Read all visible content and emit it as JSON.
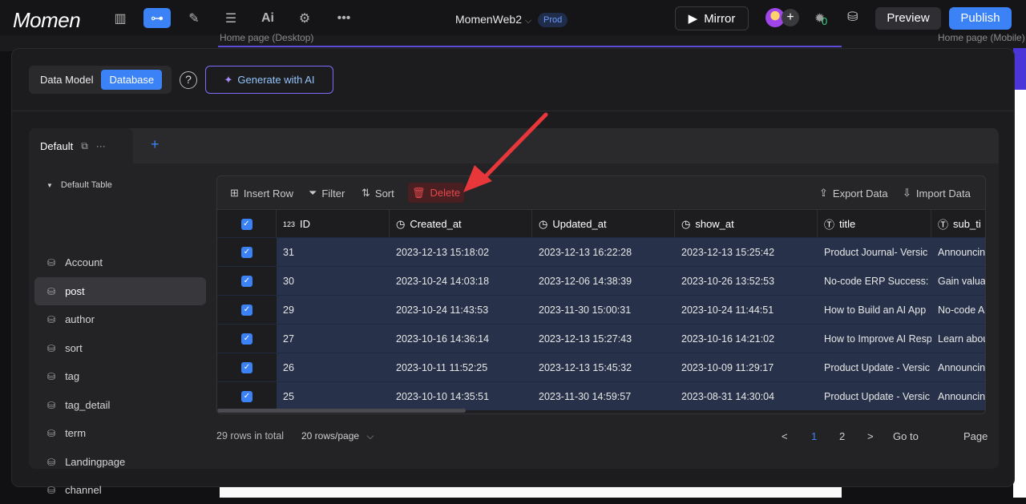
{
  "topbar": {
    "logo": "Momen",
    "project_name": "MomenWeb2",
    "env_badge": "Prod",
    "mirror_label": "Mirror",
    "bug_count": "0",
    "preview_label": "Preview",
    "publish_label": "Publish"
  },
  "background": {
    "left_page_label": "Home page (Desktop)",
    "right_page_label": "Home page (Mobile)"
  },
  "modal": {
    "seg_data_model": "Data Model",
    "seg_database": "Database",
    "help": "?",
    "generate_ai": "Generate with AI"
  },
  "panel": {
    "tab_name": "Default",
    "table_group": "Default Table",
    "tables": [
      "Account",
      "post",
      "author",
      "sort",
      "tag",
      "tag_detail",
      "term",
      "Landingpage",
      "channel"
    ],
    "selected_table": "post"
  },
  "toolbar": {
    "insert_row": "Insert Row",
    "filter": "Filter",
    "sort": "Sort",
    "delete": "Delete",
    "export": "Export Data",
    "import": "Import Data"
  },
  "columns": [
    {
      "label": "ID",
      "type": "123"
    },
    {
      "label": "Created_at",
      "type": "time"
    },
    {
      "label": "Updated_at",
      "type": "time"
    },
    {
      "label": "show_at",
      "type": "time"
    },
    {
      "label": "title",
      "type": "text"
    },
    {
      "label": "sub_ti",
      "type": "text"
    }
  ],
  "rows": [
    [
      "31",
      "2023-12-13 15:18:02",
      "2023-12-13 16:22:28",
      "2023-12-13 15:25:42",
      "Product Journal- Versic",
      "Announcin"
    ],
    [
      "30",
      "2023-10-24 14:03:18",
      "2023-12-06 14:38:39",
      "2023-10-26 13:52:53",
      "No-code ERP Success:",
      "Gain valua"
    ],
    [
      "29",
      "2023-10-24 11:43:53",
      "2023-11-30 15:00:31",
      "2023-10-24 11:44:51",
      "How to Build an AI App",
      "No-code A"
    ],
    [
      "27",
      "2023-10-16 14:36:14",
      "2023-12-13 15:27:43",
      "2023-10-16 14:21:02",
      "How to Improve AI Resp",
      "Learn abou"
    ],
    [
      "26",
      "2023-10-11 11:52:25",
      "2023-12-13 15:45:32",
      "2023-10-09 11:29:17",
      "Product Update - Versic",
      "Announcin"
    ],
    [
      "25",
      "2023-10-10 14:35:51",
      "2023-11-30 14:59:57",
      "2023-08-31 14:30:04",
      "Product Update - Versic",
      "Announcin"
    ]
  ],
  "footer": {
    "total": "29 rows in total",
    "page_size": "20 rows/page",
    "prev": "<",
    "page1": "1",
    "page2": "2",
    "next": ">",
    "goto": "Go to",
    "page_suffix": "Page"
  },
  "colors": {
    "accent": "#3b82f6",
    "delete": "#e5484d",
    "annotation_arrow": "#e8373b"
  }
}
